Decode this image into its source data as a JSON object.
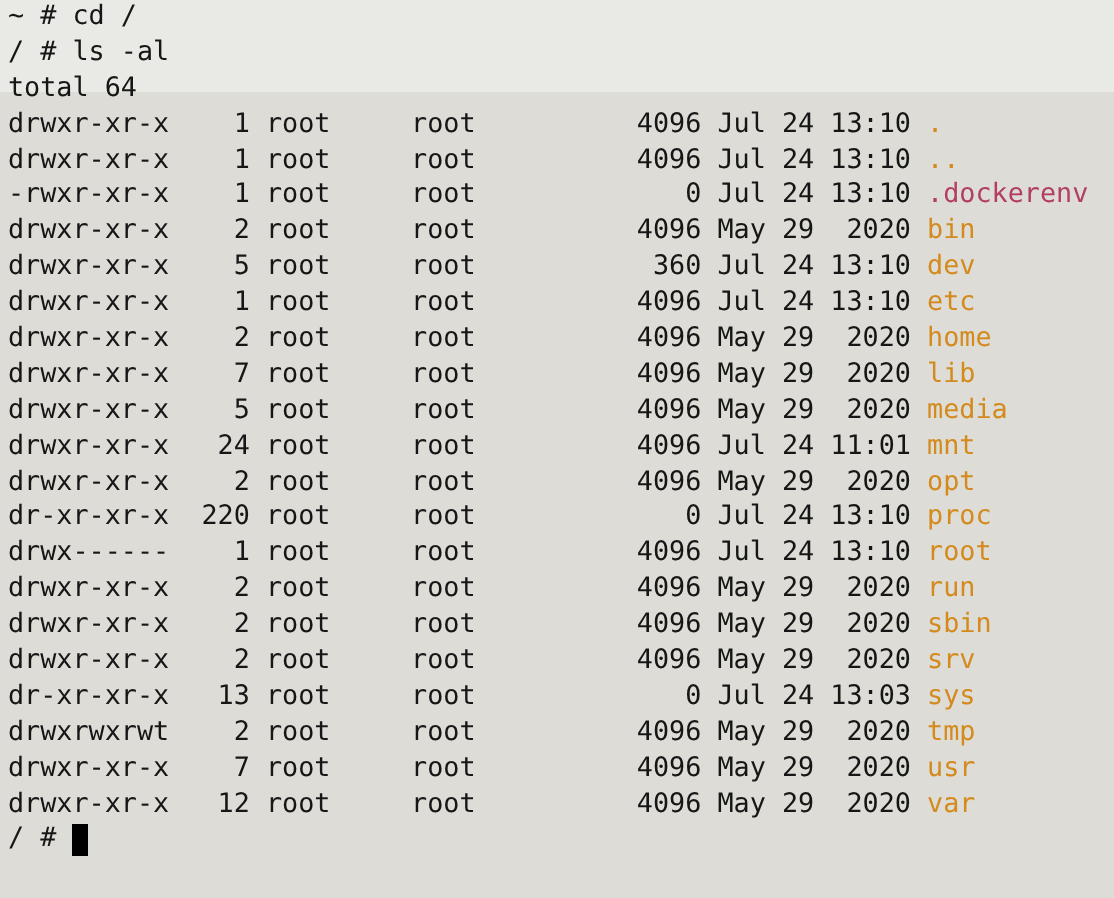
{
  "terminal": {
    "lines": [
      {
        "kind": "command",
        "text": "~ # cd /"
      },
      {
        "kind": "command",
        "text": "/ # ls -al"
      },
      {
        "kind": "output",
        "text": "total 64"
      },
      {
        "kind": "entry",
        "details": "drwxr-xr-x    1 root     root          4096 Jul 24 13:10",
        "name": ".",
        "color": "#d48a1c"
      },
      {
        "kind": "entry",
        "details": "drwxr-xr-x    1 root     root          4096 Jul 24 13:10",
        "name": "..",
        "color": "#d48a1c"
      },
      {
        "kind": "entry",
        "details": "-rwxr-xr-x    1 root     root             0 Jul 24 13:10",
        "name": ".dockerenv",
        "color": "#b23f62"
      },
      {
        "kind": "entry",
        "details": "drwxr-xr-x    2 root     root          4096 May 29  2020",
        "name": "bin",
        "color": "#d48a1c"
      },
      {
        "kind": "entry",
        "details": "drwxr-xr-x    5 root     root           360 Jul 24 13:10",
        "name": "dev",
        "color": "#d48a1c"
      },
      {
        "kind": "entry",
        "details": "drwxr-xr-x    1 root     root          4096 Jul 24 13:10",
        "name": "etc",
        "color": "#d48a1c"
      },
      {
        "kind": "entry",
        "details": "drwxr-xr-x    2 root     root          4096 May 29  2020",
        "name": "home",
        "color": "#d48a1c"
      },
      {
        "kind": "entry",
        "details": "drwxr-xr-x    7 root     root          4096 May 29  2020",
        "name": "lib",
        "color": "#d48a1c"
      },
      {
        "kind": "entry",
        "details": "drwxr-xr-x    5 root     root          4096 May 29  2020",
        "name": "media",
        "color": "#d48a1c"
      },
      {
        "kind": "entry",
        "details": "drwxr-xr-x   24 root     root          4096 Jul 24 11:01",
        "name": "mnt",
        "color": "#d48a1c"
      },
      {
        "kind": "entry",
        "details": "drwxr-xr-x    2 root     root          4096 May 29  2020",
        "name": "opt",
        "color": "#d48a1c"
      },
      {
        "kind": "entry",
        "details": "dr-xr-xr-x  220 root     root             0 Jul 24 13:10",
        "name": "proc",
        "color": "#d48a1c"
      },
      {
        "kind": "entry",
        "details": "drwx------    1 root     root          4096 Jul 24 13:10",
        "name": "root",
        "color": "#d48a1c"
      },
      {
        "kind": "entry",
        "details": "drwxr-xr-x    2 root     root          4096 May 29  2020",
        "name": "run",
        "color": "#d48a1c"
      },
      {
        "kind": "entry",
        "details": "drwxr-xr-x    2 root     root          4096 May 29  2020",
        "name": "sbin",
        "color": "#d48a1c"
      },
      {
        "kind": "entry",
        "details": "drwxr-xr-x    2 root     root          4096 May 29  2020",
        "name": "srv",
        "color": "#d48a1c"
      },
      {
        "kind": "entry",
        "details": "dr-xr-xr-x   13 root     root             0 Jul 24 13:03",
        "name": "sys",
        "color": "#d48a1c"
      },
      {
        "kind": "entry",
        "details": "drwxrwxrwt    2 root     root          4096 May 29  2020",
        "name": "tmp",
        "color": "#d48a1c"
      },
      {
        "kind": "entry",
        "details": "drwxr-xr-x    7 root     root          4096 May 29  2020",
        "name": "usr",
        "color": "#d48a1c"
      },
      {
        "kind": "entry",
        "details": "drwxr-xr-x   12 root     root          4096 May 29  2020",
        "name": "var",
        "color": "#d48a1c"
      }
    ],
    "prompt": {
      "text": "/ #",
      "cursor": true
    }
  }
}
